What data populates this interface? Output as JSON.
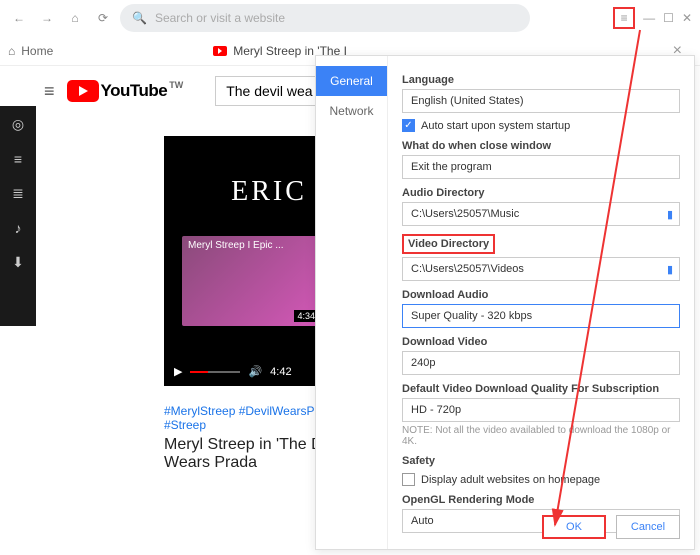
{
  "topbar": {
    "search_placeholder": "Search or visit a website"
  },
  "tabs": {
    "home": "Home",
    "video": "Meryl Streep in 'The I"
  },
  "youtube": {
    "brand": "YouTube",
    "region": "TW",
    "search_value": "The devil wea"
  },
  "video": {
    "bg_text": "ERIC",
    "thumb_title": "Meryl Streep I Epic ...",
    "thumb_duration": "4:34",
    "elapsed": "4:42",
    "tags": "#MerylStreep #DevilWearsPrada #Streep",
    "title": "Meryl Streep in 'The Devil Wears Prada"
  },
  "dialog": {
    "tabs": {
      "general": "General",
      "network": "Network"
    },
    "language_label": "Language",
    "language_value": "English (United States)",
    "autostart_label": "Auto start upon system startup",
    "close_label": "What do when close window",
    "close_value": "Exit the program",
    "audio_dir_label": "Audio Directory",
    "audio_dir_value": "C:\\Users\\25057\\Music",
    "video_dir_label": "Video Directory",
    "video_dir_value": "C:\\Users\\25057\\Videos",
    "dl_audio_label": "Download Audio",
    "dl_audio_value": "Super Quality - 320 kbps",
    "dl_video_label": "Download Video",
    "dl_video_value": "240p",
    "default_q_label": "Default Video Download Quality For Subscription",
    "default_q_value": "HD - 720p",
    "note": "NOTE: Not all the video availabled to download the 1080p or 4K.",
    "safety_label": "Safety",
    "safety_opt": "Display adult websites on homepage",
    "opengl_label": "OpenGL Rendering Mode",
    "opengl_value": "Auto",
    "ok": "OK",
    "cancel": "Cancel"
  }
}
